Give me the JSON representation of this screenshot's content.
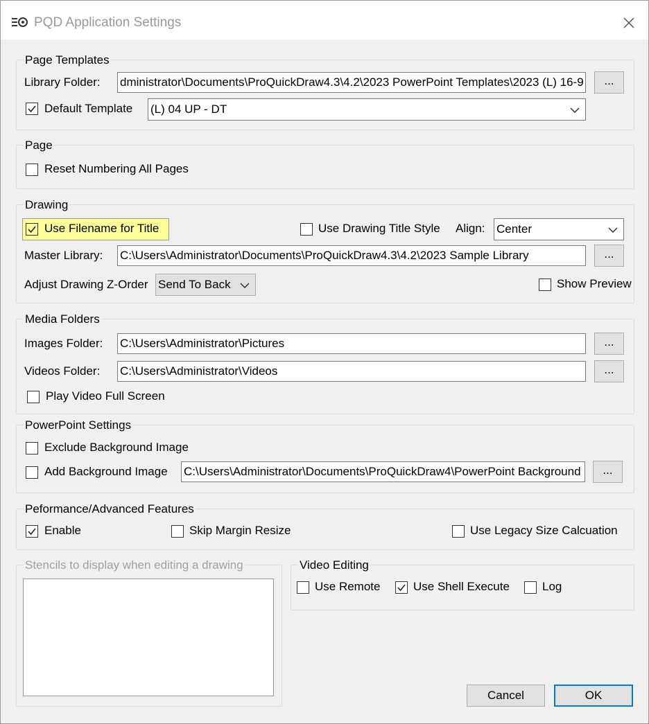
{
  "window": {
    "title": "PQD Application Settings"
  },
  "page_templates": {
    "group_label": "Page Templates",
    "library_folder_label": "Library Folder:",
    "library_folder_value": "dministrator\\Documents\\ProQuickDraw4.3\\4.2\\2023 PowerPoint Templates\\2023 (L) 16-9",
    "browse_label": "...",
    "default_template_label": "Default Template",
    "default_template_checked": true,
    "default_template_value": "(L) 04 UP - DT"
  },
  "page": {
    "group_label": "Page",
    "reset_numbering_label": "Reset Numbering All Pages",
    "reset_numbering_checked": false
  },
  "drawing": {
    "group_label": "Drawing",
    "use_filename_label": "Use Filename for Title",
    "use_filename_checked": true,
    "use_drawing_title_style_label": "Use Drawing Title Style",
    "use_drawing_title_style_checked": false,
    "align_label": "Align:",
    "align_value": "Center",
    "master_library_label": "Master Library:",
    "master_library_value": "C:\\Users\\Administrator\\Documents\\ProQuickDraw4.3\\4.2\\2023 Sample Library",
    "browse_label": "...",
    "z_order_label": "Adjust Drawing Z-Order",
    "z_order_value": "Send To Back",
    "show_preview_label": "Show Preview",
    "show_preview_checked": false
  },
  "media_folders": {
    "group_label": "Media Folders",
    "images_label": "Images Folder:",
    "images_value": "C:\\Users\\Administrator\\Pictures",
    "videos_label": "Videos Folder:",
    "videos_value": "C:\\Users\\Administrator\\Videos",
    "browse_label": "...",
    "play_full_screen_label": "Play Video Full Screen",
    "play_full_screen_checked": false
  },
  "powerpoint": {
    "group_label": "PowerPoint Settings",
    "exclude_bg_label": "Exclude Background Image",
    "exclude_bg_checked": false,
    "add_bg_label": "Add Background Image",
    "add_bg_checked": false,
    "add_bg_value": "C:\\Users\\Administrator\\Documents\\ProQuickDraw4\\PowerPoint Background",
    "browse_label": "..."
  },
  "performance": {
    "group_label": "Peformance/Advanced Features",
    "enable_label": "Enable",
    "enable_checked": true,
    "skip_margin_label": "Skip Margin Resize",
    "skip_margin_checked": false,
    "legacy_size_label": "Use Legacy Size Calcuation",
    "legacy_size_checked": false
  },
  "stencils": {
    "group_label": "Stencils to display when editing a drawing"
  },
  "video_editing": {
    "group_label": "Video Editing",
    "use_remote_label": "Use Remote",
    "use_remote_checked": false,
    "use_shell_label": "Use Shell Execute",
    "use_shell_checked": true,
    "log_label": "Log",
    "log_checked": false
  },
  "footer": {
    "cancel_label": "Cancel",
    "ok_label": "OK"
  },
  "colors": {
    "highlight": "#ffff99",
    "ok_border": "#0078d7",
    "window_bg": "#f0f0f0"
  }
}
